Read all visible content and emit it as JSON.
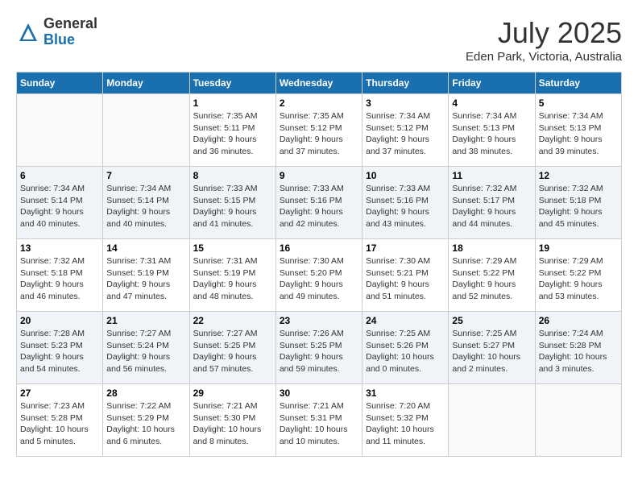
{
  "header": {
    "logo_general": "General",
    "logo_blue": "Blue",
    "month": "July 2025",
    "location": "Eden Park, Victoria, Australia"
  },
  "days_of_week": [
    "Sunday",
    "Monday",
    "Tuesday",
    "Wednesday",
    "Thursday",
    "Friday",
    "Saturday"
  ],
  "weeks": [
    [
      {
        "day": "",
        "info": ""
      },
      {
        "day": "",
        "info": ""
      },
      {
        "day": "1",
        "info": "Sunrise: 7:35 AM\nSunset: 5:11 PM\nDaylight: 9 hours\nand 36 minutes."
      },
      {
        "day": "2",
        "info": "Sunrise: 7:35 AM\nSunset: 5:12 PM\nDaylight: 9 hours\nand 37 minutes."
      },
      {
        "day": "3",
        "info": "Sunrise: 7:34 AM\nSunset: 5:12 PM\nDaylight: 9 hours\nand 37 minutes."
      },
      {
        "day": "4",
        "info": "Sunrise: 7:34 AM\nSunset: 5:13 PM\nDaylight: 9 hours\nand 38 minutes."
      },
      {
        "day": "5",
        "info": "Sunrise: 7:34 AM\nSunset: 5:13 PM\nDaylight: 9 hours\nand 39 minutes."
      }
    ],
    [
      {
        "day": "6",
        "info": "Sunrise: 7:34 AM\nSunset: 5:14 PM\nDaylight: 9 hours\nand 40 minutes."
      },
      {
        "day": "7",
        "info": "Sunrise: 7:34 AM\nSunset: 5:14 PM\nDaylight: 9 hours\nand 40 minutes."
      },
      {
        "day": "8",
        "info": "Sunrise: 7:33 AM\nSunset: 5:15 PM\nDaylight: 9 hours\nand 41 minutes."
      },
      {
        "day": "9",
        "info": "Sunrise: 7:33 AM\nSunset: 5:16 PM\nDaylight: 9 hours\nand 42 minutes."
      },
      {
        "day": "10",
        "info": "Sunrise: 7:33 AM\nSunset: 5:16 PM\nDaylight: 9 hours\nand 43 minutes."
      },
      {
        "day": "11",
        "info": "Sunrise: 7:32 AM\nSunset: 5:17 PM\nDaylight: 9 hours\nand 44 minutes."
      },
      {
        "day": "12",
        "info": "Sunrise: 7:32 AM\nSunset: 5:18 PM\nDaylight: 9 hours\nand 45 minutes."
      }
    ],
    [
      {
        "day": "13",
        "info": "Sunrise: 7:32 AM\nSunset: 5:18 PM\nDaylight: 9 hours\nand 46 minutes."
      },
      {
        "day": "14",
        "info": "Sunrise: 7:31 AM\nSunset: 5:19 PM\nDaylight: 9 hours\nand 47 minutes."
      },
      {
        "day": "15",
        "info": "Sunrise: 7:31 AM\nSunset: 5:19 PM\nDaylight: 9 hours\nand 48 minutes."
      },
      {
        "day": "16",
        "info": "Sunrise: 7:30 AM\nSunset: 5:20 PM\nDaylight: 9 hours\nand 49 minutes."
      },
      {
        "day": "17",
        "info": "Sunrise: 7:30 AM\nSunset: 5:21 PM\nDaylight: 9 hours\nand 51 minutes."
      },
      {
        "day": "18",
        "info": "Sunrise: 7:29 AM\nSunset: 5:22 PM\nDaylight: 9 hours\nand 52 minutes."
      },
      {
        "day": "19",
        "info": "Sunrise: 7:29 AM\nSunset: 5:22 PM\nDaylight: 9 hours\nand 53 minutes."
      }
    ],
    [
      {
        "day": "20",
        "info": "Sunrise: 7:28 AM\nSunset: 5:23 PM\nDaylight: 9 hours\nand 54 minutes."
      },
      {
        "day": "21",
        "info": "Sunrise: 7:27 AM\nSunset: 5:24 PM\nDaylight: 9 hours\nand 56 minutes."
      },
      {
        "day": "22",
        "info": "Sunrise: 7:27 AM\nSunset: 5:25 PM\nDaylight: 9 hours\nand 57 minutes."
      },
      {
        "day": "23",
        "info": "Sunrise: 7:26 AM\nSunset: 5:25 PM\nDaylight: 9 hours\nand 59 minutes."
      },
      {
        "day": "24",
        "info": "Sunrise: 7:25 AM\nSunset: 5:26 PM\nDaylight: 10 hours\nand 0 minutes."
      },
      {
        "day": "25",
        "info": "Sunrise: 7:25 AM\nSunset: 5:27 PM\nDaylight: 10 hours\nand 2 minutes."
      },
      {
        "day": "26",
        "info": "Sunrise: 7:24 AM\nSunset: 5:28 PM\nDaylight: 10 hours\nand 3 minutes."
      }
    ],
    [
      {
        "day": "27",
        "info": "Sunrise: 7:23 AM\nSunset: 5:28 PM\nDaylight: 10 hours\nand 5 minutes."
      },
      {
        "day": "28",
        "info": "Sunrise: 7:22 AM\nSunset: 5:29 PM\nDaylight: 10 hours\nand 6 minutes."
      },
      {
        "day": "29",
        "info": "Sunrise: 7:21 AM\nSunset: 5:30 PM\nDaylight: 10 hours\nand 8 minutes."
      },
      {
        "day": "30",
        "info": "Sunrise: 7:21 AM\nSunset: 5:31 PM\nDaylight: 10 hours\nand 10 minutes."
      },
      {
        "day": "31",
        "info": "Sunrise: 7:20 AM\nSunset: 5:32 PM\nDaylight: 10 hours\nand 11 minutes."
      },
      {
        "day": "",
        "info": ""
      },
      {
        "day": "",
        "info": ""
      }
    ]
  ]
}
